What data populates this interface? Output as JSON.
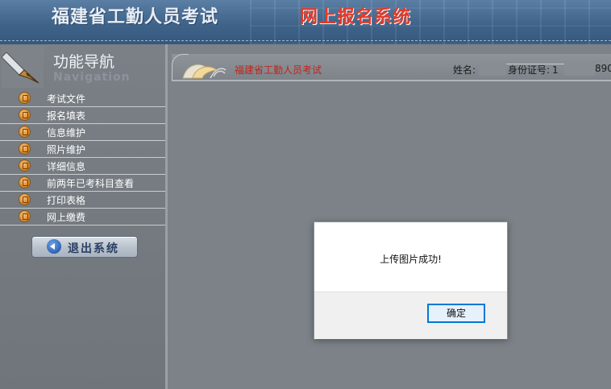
{
  "banner": {
    "title_main": "福建省工勤人员考试",
    "title_system": "网上报名系统"
  },
  "sidebar": {
    "title": "功能导航",
    "subtitle": "Navigation",
    "items": [
      {
        "label": "考试文件"
      },
      {
        "label": "报名填表"
      },
      {
        "label": "信息维护"
      },
      {
        "label": "照片维护"
      },
      {
        "label": "详细信息"
      },
      {
        "label": "前两年已考科目查看"
      },
      {
        "label": "打印表格"
      },
      {
        "label": "网上缴费"
      }
    ],
    "logout_label": "退出系统"
  },
  "header_bar": {
    "title": "福建省工勤人员考试",
    "name_label": "姓名:",
    "id_label": "身份证号:",
    "id_visible_start": "1",
    "id_visible_end": "890"
  },
  "dialog": {
    "message": "上传图片成功!",
    "ok_label": "确定"
  },
  "colors": {
    "banner_blue": "#3f6389",
    "system_title_red": "#e33a2a",
    "header_title_red": "#c1231a",
    "dialog_button_border": "#0078d7"
  }
}
